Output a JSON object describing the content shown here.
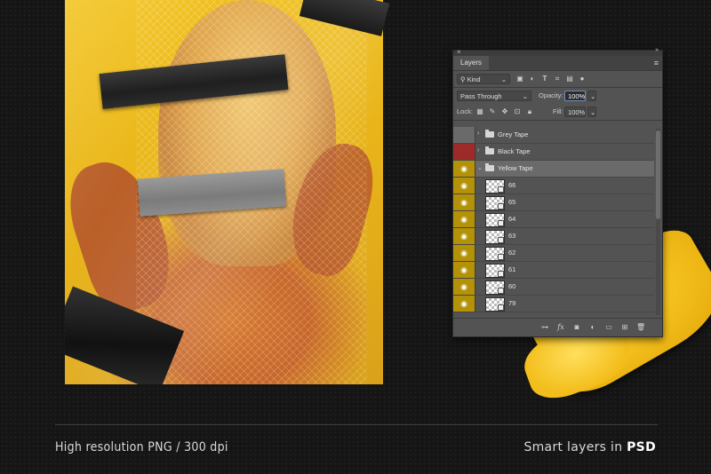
{
  "captions": {
    "left": "High resolution PNG / 300 dpi",
    "right_prefix": "Smart layers in ",
    "right_bold": "PSD"
  },
  "panel": {
    "title": "Layers",
    "filter_kind": "Kind",
    "blend_mode": "Pass Through",
    "opacity_label": "Opacity:",
    "opacity_value": "100%",
    "lock_label": "Lock:",
    "fill_label": "Fill:",
    "fill_value": "100%",
    "groups": [
      {
        "name": "Grey Tape",
        "visible": false
      },
      {
        "name": "Black Tape",
        "visible": false
      },
      {
        "name": "Yellow Tape",
        "visible": true,
        "expanded": true
      }
    ],
    "layers": [
      "66",
      "65",
      "64",
      "63",
      "62",
      "61",
      "60",
      "79"
    ],
    "icons": [
      "close-icon",
      "panel-menu-icon",
      "search-icon",
      "image-filter-icon",
      "adjustment-filter-icon",
      "text-filter-icon",
      "shape-filter-icon",
      "smart-object-filter-icon",
      "link-icon",
      "fx-icon",
      "mask-icon",
      "adjustment-icon",
      "folder-icon",
      "new-layer-icon",
      "trash-icon"
    ],
    "colors": {
      "group_red": "#9e2a2a",
      "group_yellow": "#b39208",
      "panel_bg": "#535353"
    }
  }
}
